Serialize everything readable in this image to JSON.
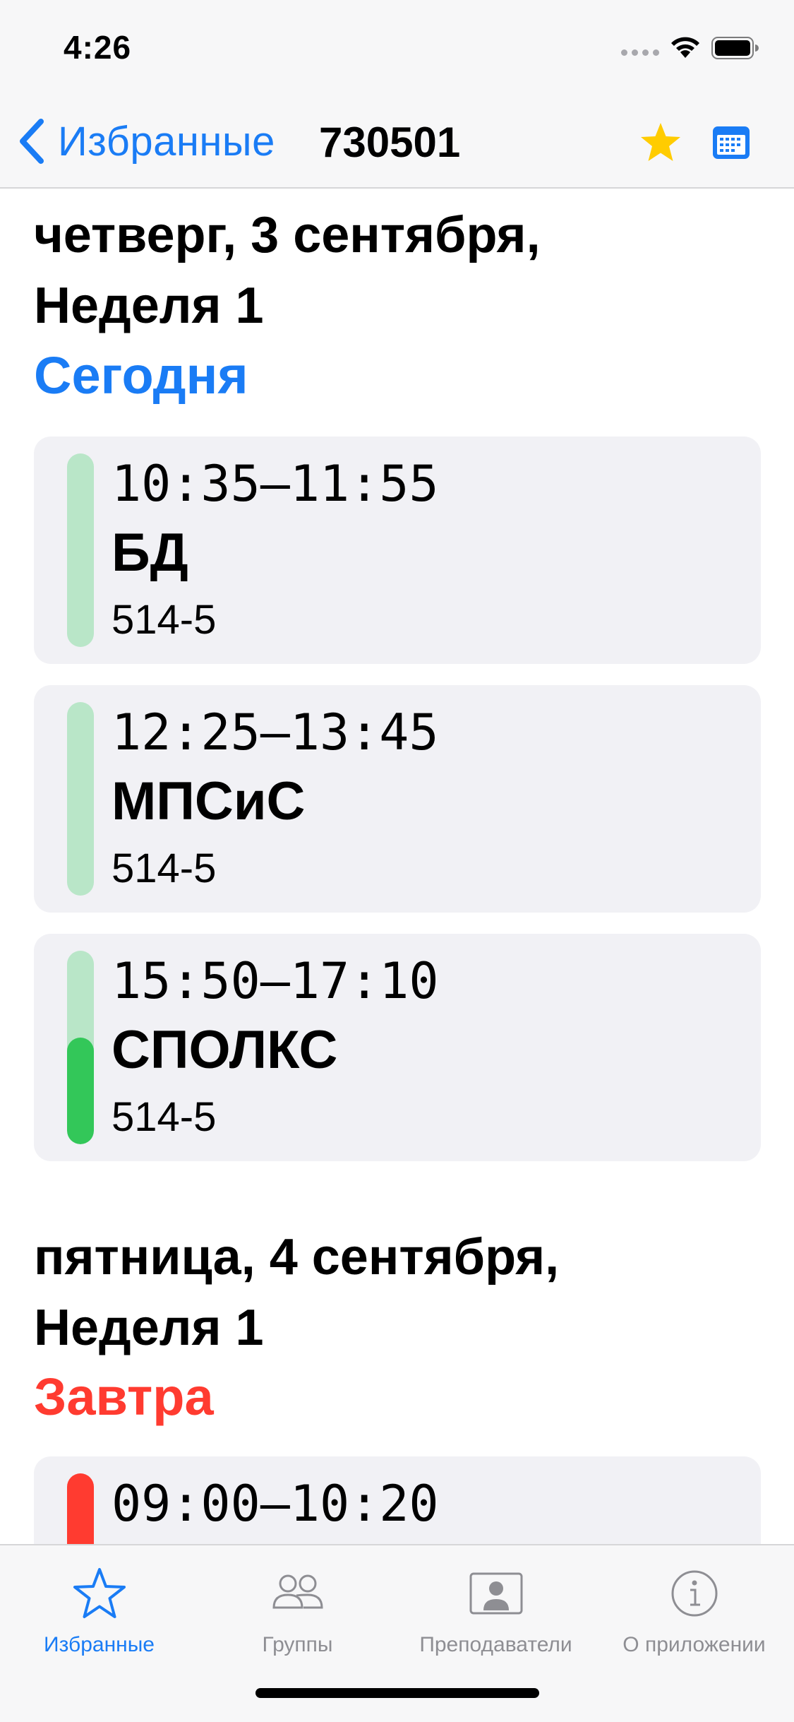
{
  "status_bar": {
    "time": "4:26"
  },
  "nav": {
    "back_label": "Избранные",
    "title": "730501",
    "icons": [
      "chevron-left-icon",
      "star-icon",
      "calendar-icon"
    ],
    "accent_color": "#1a7cf5",
    "star_color": "#ffcc00"
  },
  "days": [
    {
      "header_line1": "четверг, 3 сентября,",
      "header_line2": "Неделя 1",
      "relative": "Сегодня",
      "relative_color": "#1a7cf5",
      "lessons": [
        {
          "time": "10:35–11:55",
          "subject": "БД",
          "room": "514-5",
          "progress": 0
        },
        {
          "time": "12:25–13:45",
          "subject": "МПСиС",
          "room": "514-5",
          "progress": 0
        },
        {
          "time": "15:50–17:10",
          "subject": "СПОЛКС",
          "room": "514-5",
          "progress": 0.55
        }
      ]
    },
    {
      "header_line1": "пятница, 4 сентября,",
      "header_line2": "Неделя 1",
      "relative": "Завтра",
      "relative_color": "#ff3b30",
      "lessons": [
        {
          "time": "09:00–10:20",
          "subject": "",
          "room": "",
          "bar_color": "#ff3b30"
        }
      ]
    }
  ],
  "tabs": [
    {
      "label": "Избранные",
      "icon": "star-icon",
      "active": true
    },
    {
      "label": "Группы",
      "icon": "people-icon",
      "active": false
    },
    {
      "label": "Преподаватели",
      "icon": "person-portrait-icon",
      "active": false
    },
    {
      "label": "О приложении",
      "icon": "info-icon",
      "active": false
    }
  ]
}
